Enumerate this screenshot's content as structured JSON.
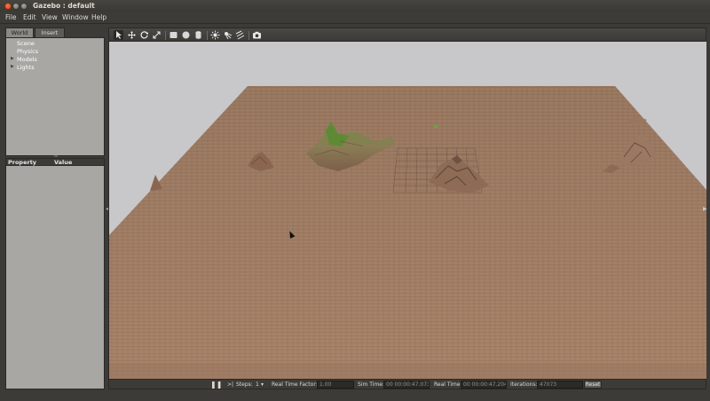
{
  "window": {
    "title": "Gazebo : default"
  },
  "menu": {
    "file": "File",
    "edit": "Edit",
    "view": "View",
    "window": "Window",
    "help": "Help"
  },
  "left_panel": {
    "tabs": {
      "world": "World",
      "insert": "Insert"
    },
    "tree": {
      "scene": "Scene",
      "physics": "Physics",
      "models": "Models",
      "lights": "Lights"
    },
    "props": {
      "property": "Property",
      "value": "Value"
    }
  },
  "toolbar": {
    "icons": [
      "select-arrow-icon",
      "translate-icon",
      "rotate-icon",
      "scale-icon",
      "box-icon",
      "sphere-icon",
      "cylinder-icon",
      "point-light-icon",
      "spot-light-icon",
      "directional-light-icon",
      "screenshot-icon"
    ]
  },
  "bottom_bar": {
    "steps_label": "Steps:",
    "steps_value": "1",
    "rtf_label": "Real Time Factor:",
    "rtf_value": "1.00",
    "sim_time_label": "Sim Time:",
    "sim_time_value": "00 00:00:47.073",
    "real_time_label": "Real Time:",
    "real_time_value": "00 00:00:47.204",
    "iterations_label": "Iterations:",
    "iterations_value": "47073",
    "reset_label": "Reset"
  },
  "colors": {
    "sky": "#c8c8ca",
    "ground": "#a58167",
    "ground_line": "#8f6d55",
    "accent_green": "#6aa33a"
  }
}
